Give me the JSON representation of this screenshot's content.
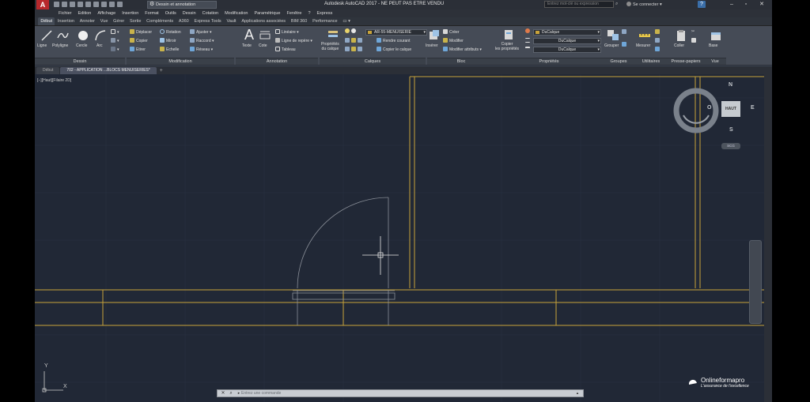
{
  "title_bar": {
    "app_letter": "A",
    "workspace": "Dessin et annotation",
    "title": "Autodesk AutoCAD 2017 - NE PEUT PAS ETRE VENDU",
    "search_placeholder": "Entrez mot-clé ou expression",
    "sign_in": "Se connecter"
  },
  "menu": [
    "Fichier",
    "Edition",
    "Affichage",
    "Insertion",
    "Format",
    "Outils",
    "Dessin",
    "Cotation",
    "Modification",
    "Paramétrique",
    "Fenêtre",
    "?",
    "Express"
  ],
  "ribbon_tabs": [
    "Début",
    "Insertion",
    "Annoter",
    "Vue",
    "Gérer",
    "Sortie",
    "Compléments",
    "A360",
    "Express Tools",
    "Vault",
    "Applications associées",
    "BIM 360",
    "Performance"
  ],
  "ribbon": {
    "dessin": {
      "ligne": "Ligne",
      "polyligne": "Polyligne",
      "cercle": "Cercle",
      "arc": "Arc",
      "label": "Dessin"
    },
    "modification": {
      "deplacer": "Déplacer",
      "rotation": "Rotation",
      "ajuster": "Ajuster",
      "copier": "Copier",
      "miroir": "Miroir",
      "raccord": "Raccord",
      "etirer": "Etirer",
      "echelle": "Echelle",
      "reseau": "Réseau",
      "label": "Modification"
    },
    "annotation": {
      "texte": "Texte",
      "cote": "Cote",
      "lineaire": "Linéaire",
      "ligne_repere": "Ligne de repère",
      "tableau": "Tableau",
      "label": "Annotation"
    },
    "calques": {
      "proprietes": "Propriétés",
      "proprietes2": "du calque",
      "layer": "AR-55-MENUISERIE",
      "rendre_courant": "Rendre courant",
      "copier_calque": "Copier le calque",
      "label": "Calques"
    },
    "bloc": {
      "inserer": "Insérer",
      "creer": "Créer",
      "modifier": "Modifier",
      "modifier_attributs": "Modifier attributs",
      "label": "Bloc"
    },
    "proprietes": {
      "copier": "Copier",
      "copier2": "les propriétés",
      "color": "DuCalque",
      "linetype": "DuCalque",
      "lineweight": "DuCalque",
      "label": "Propriétés"
    },
    "groupes": {
      "grouper": "Grouper",
      "label": "Groupes"
    },
    "utilitaires": {
      "mesurer": "Mesurer",
      "label": "Utilitaires"
    },
    "presse_papiers": {
      "coller": "Coller",
      "label": "Presse-papiers"
    },
    "vue": {
      "base": "Base",
      "label": "Vue"
    }
  },
  "file_tabs": [
    "Début",
    "702 - APPLICATION ...BLOCS MENUISERIES*"
  ],
  "viewport_label": "[−][Haut][Filaire 2D]",
  "compass": {
    "north": "N",
    "south": "S",
    "east": "E",
    "west": "O",
    "cube_face": "HAUT",
    "wcs": "SCG"
  },
  "ucs": {
    "x": "X",
    "y": "Y"
  },
  "command_line": {
    "placeholder": "Entrez une commande"
  },
  "brand": {
    "name": "Onlineformapro",
    "tagline": "L'assurance de l'excellence"
  },
  "colors": {
    "canvas": "#212836",
    "wall_line": "#c9a33a",
    "door_line": "#8a8f98",
    "accent_red": "#b8282c"
  }
}
